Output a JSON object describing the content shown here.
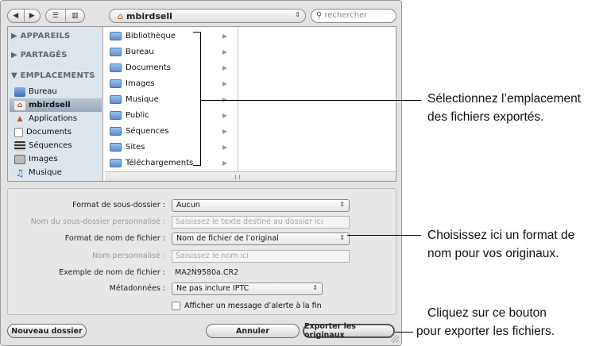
{
  "toolbar": {
    "back_glyph": "◀",
    "forward_glyph": "▶",
    "list_view_glyph": "☰",
    "column_view_glyph": "▥",
    "path_home_glyph": "⌂",
    "path_label": "mbirdsell",
    "path_arrows": "⇕",
    "search_icon": "magnifier",
    "search_placeholder": "rechercher"
  },
  "sidebar": {
    "sections": [
      {
        "label": "APPAREILS"
      },
      {
        "label": "PARTAGÉS"
      },
      {
        "label": "EMPLACEMENTS"
      }
    ],
    "items": [
      {
        "label": "Bureau",
        "icon": "desktop-icon",
        "selected": false
      },
      {
        "label": "mbirdsell",
        "icon": "home-icon",
        "selected": true
      },
      {
        "label": "Applications",
        "icon": "applications-icon",
        "selected": false
      },
      {
        "label": "Documents",
        "icon": "document-icon",
        "selected": false
      },
      {
        "label": "Séquences",
        "icon": "film-icon",
        "selected": false
      },
      {
        "label": "Images",
        "icon": "camera-icon",
        "selected": false
      },
      {
        "label": "Musique",
        "icon": "music-icon",
        "selected": false
      }
    ]
  },
  "folders": [
    {
      "label": "Bibliothèque"
    },
    {
      "label": "Bureau"
    },
    {
      "label": "Documents"
    },
    {
      "label": "Images"
    },
    {
      "label": "Musique"
    },
    {
      "label": "Public"
    },
    {
      "label": "Séquences"
    },
    {
      "label": "Sites"
    },
    {
      "label": "Téléchargements"
    }
  ],
  "options": {
    "subfolder_format_label": "Format de sous-dossier :",
    "subfolder_format_value": "Aucun",
    "custom_subfolder_label": "Nom du sous-dossier personnalisé :",
    "custom_subfolder_placeholder": "Saisissez le texte destiné au dossier ici",
    "filename_format_label": "Format de nom de fichier :",
    "filename_format_value": "Nom de fichier de l’original",
    "custom_name_label": "Nom personnalisé :",
    "custom_name_placeholder": "Saisissez le nom ici",
    "example_label": "Exemple de nom de fichier :",
    "example_value": "MA2N9580a.CR2",
    "metadata_label": "Métadonnées :",
    "metadata_value": "Ne pas inclure IPTC",
    "alert_checkbox_label": "Afficher un message d’alerte à la fin",
    "alert_checked": false
  },
  "buttons": {
    "new_folder": "Nouveau dossier",
    "cancel": "Annuler",
    "export": "Exporter les originaux"
  },
  "annotations": {
    "location_line1": "Sélectionnez l’emplacement",
    "location_line2": "des fichiers exportés.",
    "format_line1": "Choisissez ici un format de",
    "format_line2": "nom pour vos originaux.",
    "button_line1": "Cliquez sur ce bouton",
    "button_line2": "pour exporter les fichiers."
  },
  "colors": {
    "sidebar_bg": "#dde4ec",
    "selection": "#98a8bb",
    "dialog_bg": "#e2e2e2"
  }
}
